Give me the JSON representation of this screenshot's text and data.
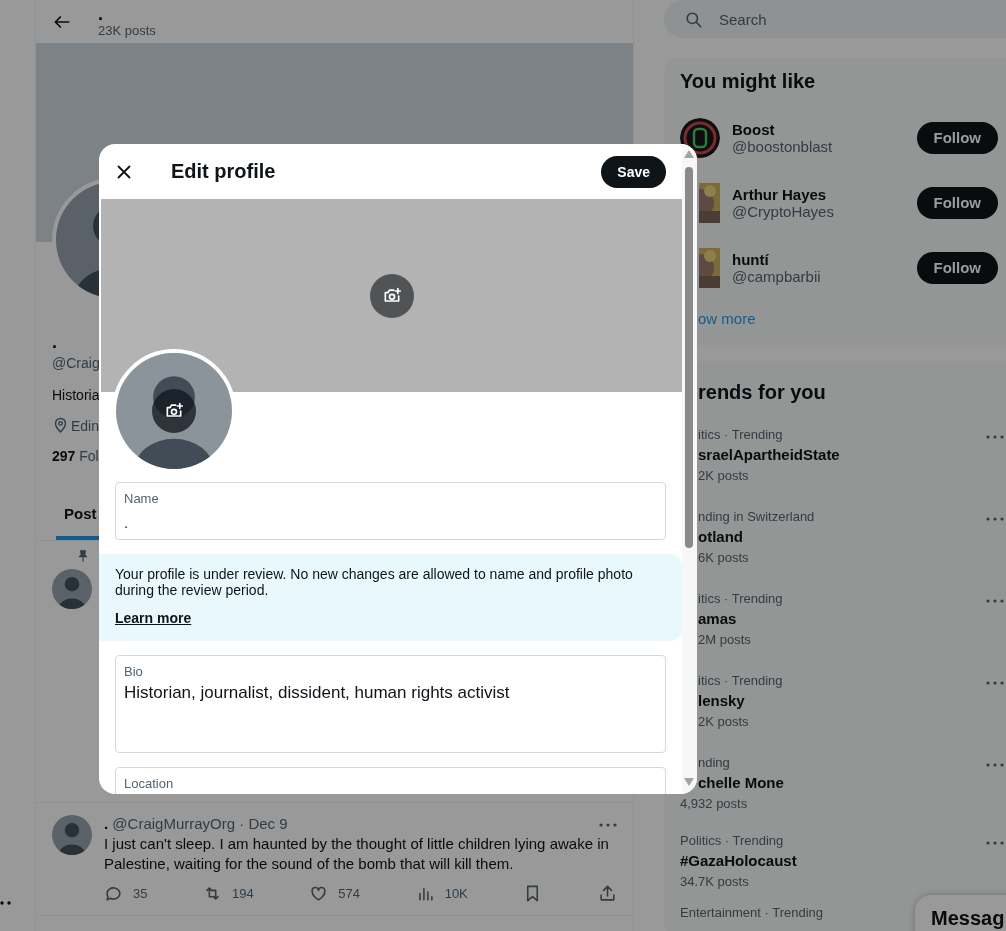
{
  "header": {
    "title": ".",
    "post_count": "23K posts"
  },
  "profile": {
    "name": ".",
    "handle": "@Craig",
    "bio": "Historia",
    "location": "Edin",
    "following_count": "297",
    "following_label": "Fol"
  },
  "profile_tabs": [
    {
      "label": "Post",
      "selected": true
    }
  ],
  "post": {
    "name": ".",
    "meta": "@CraigMurrayOrg · Dec 9",
    "text": "I just can't sleep. I am haunted by the thought of little children lying awake in Palestine, waiting for the sound of the bomb that will kill them.",
    "actions": [
      {
        "kind": "reply",
        "count": "35"
      },
      {
        "kind": "repost",
        "count": "194"
      },
      {
        "kind": "like",
        "count": "574"
      },
      {
        "kind": "views",
        "count": "10K"
      },
      {
        "kind": "bookmark"
      },
      {
        "kind": "share"
      }
    ]
  },
  "search": {
    "placeholder": "Search"
  },
  "suggestions": {
    "title": "You might like",
    "show_more": "ow more",
    "accounts": [
      {
        "name": "Boost",
        "handle": "@boostonblast",
        "button": "Follow",
        "kind": "logo"
      },
      {
        "name": "Arthur Hayes",
        "handle": "@CryptoHayes",
        "button": "Follow",
        "kind": "picture"
      },
      {
        "name": "huntí",
        "handle": "@campbarbii",
        "button": "Follow",
        "kind": "picture"
      }
    ]
  },
  "trends": {
    "title": "rends for you",
    "items": [
      {
        "category": "itics · Trending",
        "name": "sraelApartheidState",
        "posts": "2K posts"
      },
      {
        "category": "nding in Switzerland",
        "name": "otland",
        "posts": "6K posts"
      },
      {
        "category": "itics · Trending",
        "name": "amas",
        "posts": "2M posts"
      },
      {
        "category": "itics · Trending",
        "name": "lensky",
        "posts": "2K posts"
      },
      {
        "category": "nding",
        "name": "chelle Mone",
        "posts": "4,932 posts"
      },
      {
        "category": "Politics · Trending",
        "name": "#GazaHolocaust",
        "posts": "34.7K posts"
      },
      {
        "category": "Entertainment · Trending"
      }
    ]
  },
  "messages_drawer": {
    "title": "Messag"
  },
  "modal": {
    "title": "Edit profile",
    "save": "Save",
    "fields": [
      {
        "label": "Name",
        "value": ".",
        "kind": "single"
      }
    ],
    "notice": {
      "text": "Your profile is under review. No new changes are allowed to name and profile photo during the review period.",
      "link": "Learn more"
    },
    "more_fields": [
      {
        "label": "Bio",
        "value": "Historian, journalist, dissident, human rights activist",
        "kind": "multi"
      },
      {
        "label": "Location",
        "kind": "single"
      }
    ]
  }
}
